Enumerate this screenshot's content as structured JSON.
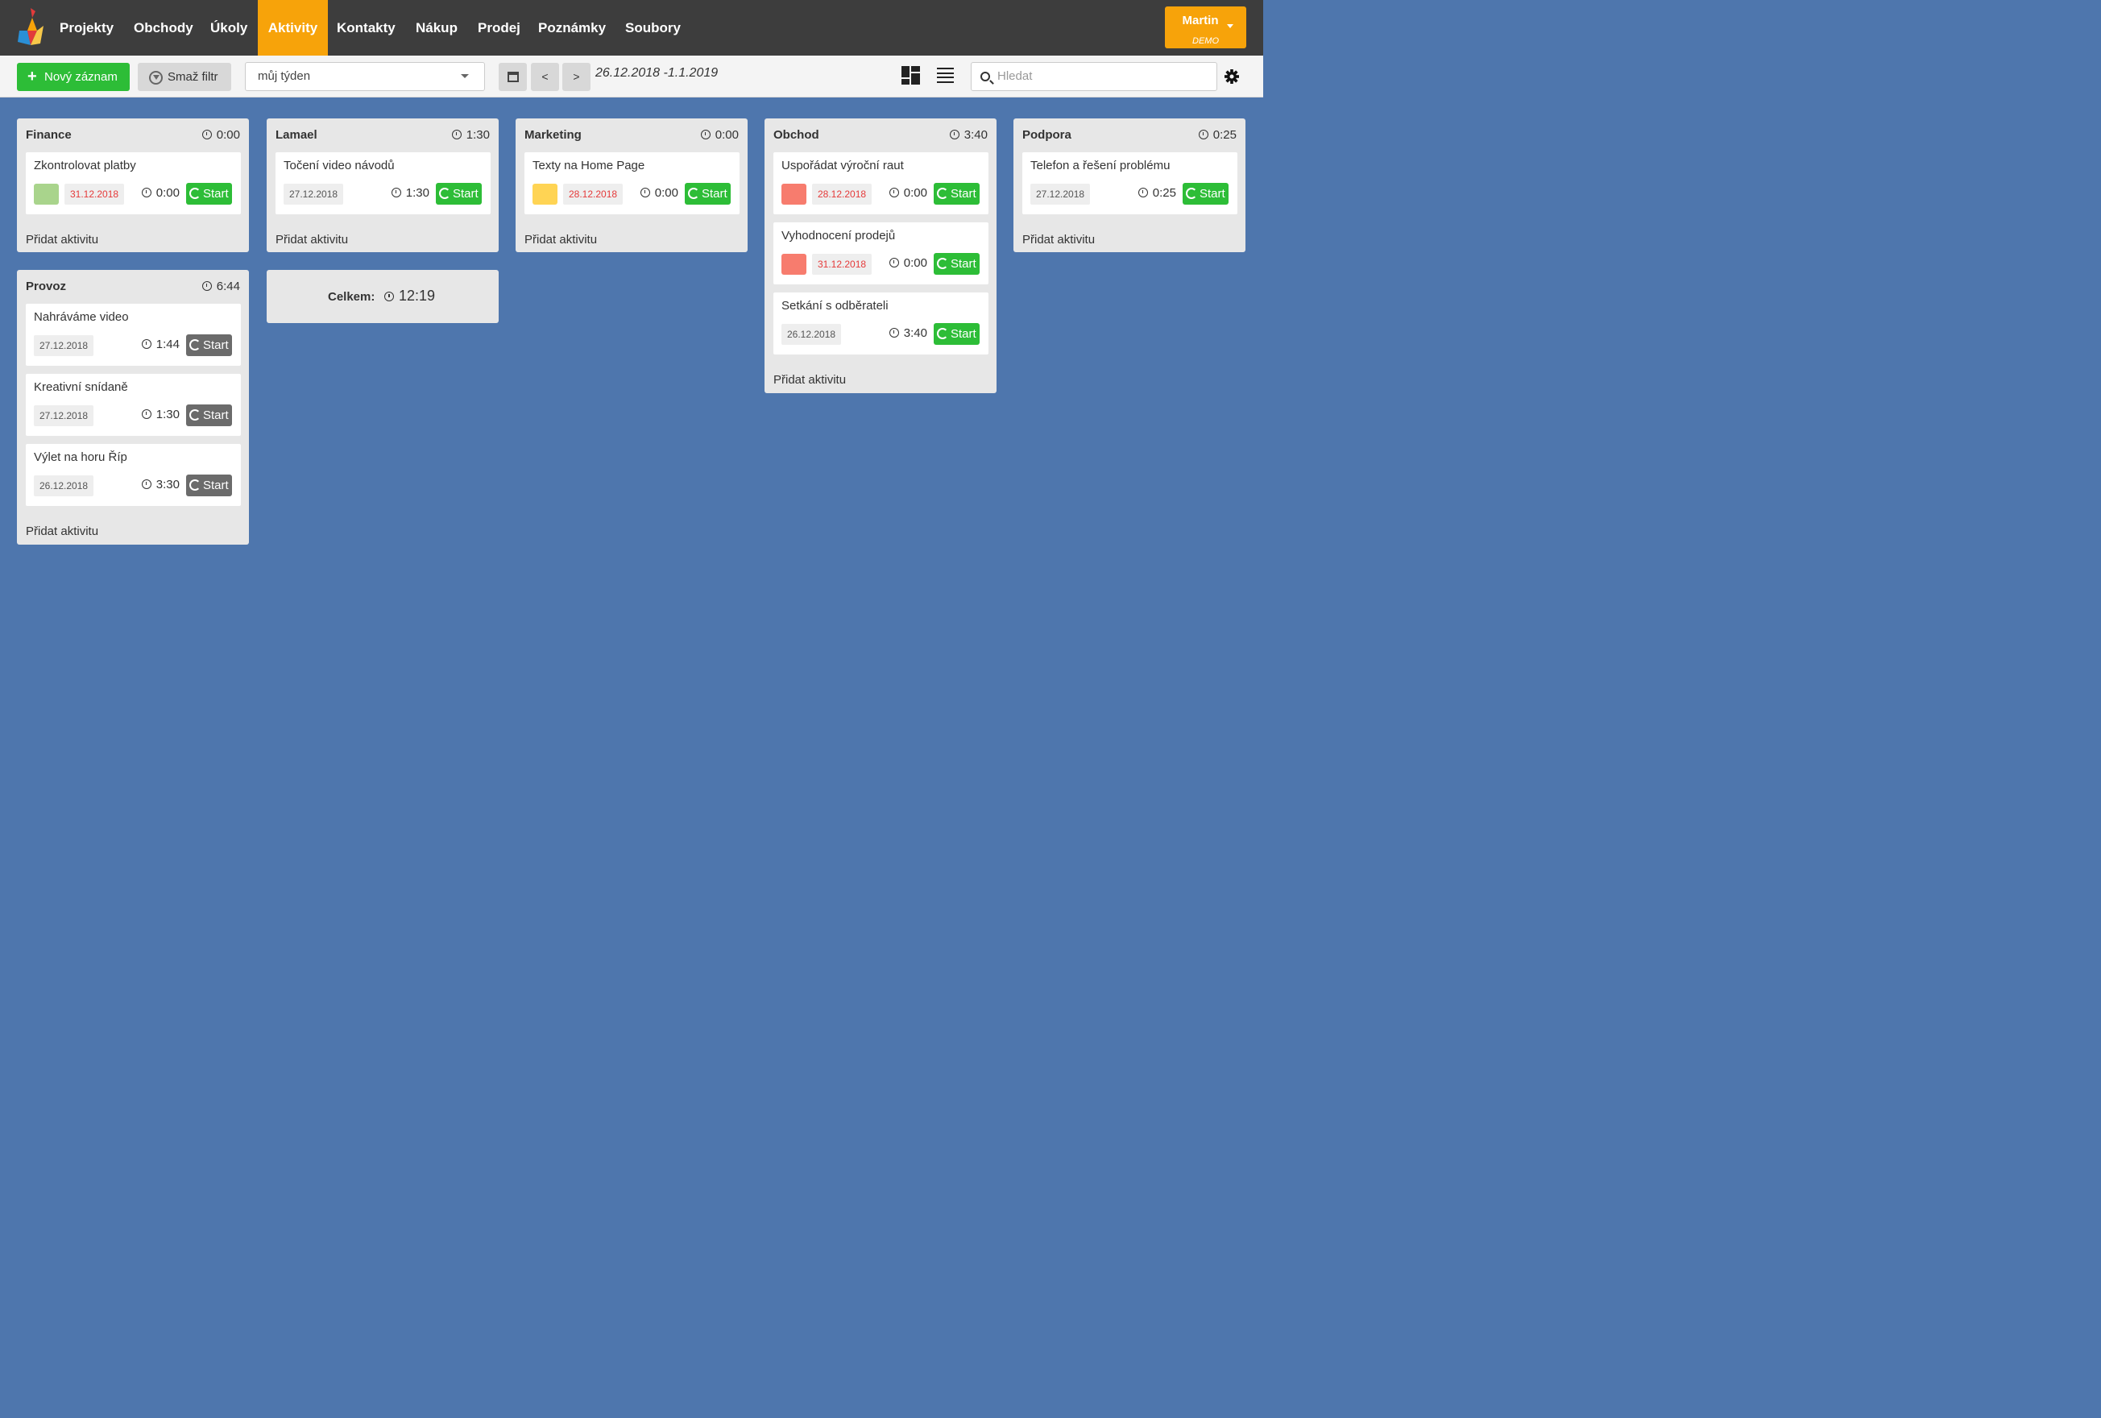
{
  "nav": {
    "items": [
      "Projekty",
      "Obchody",
      "Úkoly",
      "Aktivity",
      "Kontakty",
      "Nákup",
      "Prodej",
      "Poznámky",
      "Soubory"
    ],
    "active_index": 3,
    "user": {
      "name": "Martin",
      "subtitle": "DEMO"
    }
  },
  "toolbar": {
    "new_label": "Nový záznam",
    "filter_label": "Smaž filtr",
    "period_select": "můj týden",
    "prev_label": "<",
    "next_label": ">",
    "date_range": "26.12.2018 -1.1.2019",
    "search_placeholder": "Hledat"
  },
  "columns": [
    {
      "name": "Finance",
      "time": "0:00",
      "add_label": "Přidat aktivitu",
      "cards": [
        {
          "title": "Zkontrolovat platby",
          "date": "31.12.2018",
          "overdue": true,
          "color": "#a9d48c",
          "time": "0:00",
          "start_label": "Start",
          "start_style": "green"
        }
      ]
    },
    {
      "name": "Lamael",
      "time": "1:30",
      "add_label": "Přidat aktivitu",
      "cards": [
        {
          "title": "Točení video návodů",
          "date": "27.12.2018",
          "overdue": false,
          "color": "",
          "time": "1:30",
          "start_label": "Start",
          "start_style": "green"
        }
      ]
    },
    {
      "name": "Marketing",
      "time": "0:00",
      "add_label": "Přidat aktivitu",
      "cards": [
        {
          "title": "Texty na Home Page",
          "date": "28.12.2018",
          "overdue": true,
          "color": "#ffd454",
          "time": "0:00",
          "start_label": "Start",
          "start_style": "green"
        }
      ]
    },
    {
      "name": "Obchod",
      "time": "3:40",
      "add_label": "Přidat aktivitu",
      "cards": [
        {
          "title": "Uspořádat výroční raut",
          "date": "28.12.2018",
          "overdue": true,
          "color": "#f77c6e",
          "time": "0:00",
          "start_label": "Start",
          "start_style": "green"
        },
        {
          "title": "Vyhodnocení prodejů",
          "date": "31.12.2018",
          "overdue": true,
          "color": "#f77c6e",
          "time": "0:00",
          "start_label": "Start",
          "start_style": "green"
        },
        {
          "title": "Setkání s odběrateli",
          "date": "26.12.2018",
          "overdue": false,
          "color": "",
          "time": "3:40",
          "start_label": "Start",
          "start_style": "green"
        }
      ]
    },
    {
      "name": "Podpora",
      "time": "0:25",
      "add_label": "Přidat aktivitu",
      "cards": [
        {
          "title": "Telefon a řešení problému",
          "date": "27.12.2018",
          "overdue": false,
          "color": "",
          "time": "0:25",
          "start_label": "Start",
          "start_style": "green"
        }
      ]
    },
    {
      "name": "Provoz",
      "time": "6:44",
      "add_label": "Přidat aktivitu",
      "cards": [
        {
          "title": "Nahráváme video",
          "date": "27.12.2018",
          "overdue": false,
          "color": "",
          "time": "1:44",
          "start_label": "Start",
          "start_style": "gray"
        },
        {
          "title": "Kreativní snídaně",
          "date": "27.12.2018",
          "overdue": false,
          "color": "",
          "time": "1:30",
          "start_label": "Start",
          "start_style": "gray"
        },
        {
          "title": "Výlet na horu Říp",
          "date": "26.12.2018",
          "overdue": false,
          "color": "",
          "time": "3:30",
          "start_label": "Start",
          "start_style": "gray"
        }
      ]
    }
  ],
  "summary": {
    "label": "Celkem:",
    "time": "12:19"
  }
}
